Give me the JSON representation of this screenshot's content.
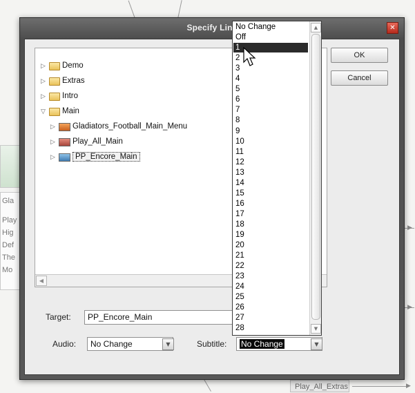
{
  "dialog": {
    "title": "Specify Link"
  },
  "buttons": {
    "ok": "OK",
    "cancel": "Cancel"
  },
  "tree": {
    "items": [
      {
        "label": "Demo",
        "expanded": false,
        "icon": "folder-icon"
      },
      {
        "label": "Extras",
        "expanded": false,
        "icon": "folder-icon"
      },
      {
        "label": "Intro",
        "expanded": false,
        "icon": "folder-icon"
      },
      {
        "label": "Main",
        "expanded": true,
        "icon": "folder-icon",
        "children": [
          {
            "label": "Gladiators_Football_Main_Menu",
            "icon": "menu-icon"
          },
          {
            "label": "Play_All_Main",
            "icon": "timeline-icon"
          },
          {
            "label": "PP_Encore_Main",
            "icon": "slideshow-icon",
            "selected": true
          }
        ]
      }
    ]
  },
  "target": {
    "label": "Target:",
    "value": "PP_Encore_Main"
  },
  "audio": {
    "label": "Audio:",
    "value": "No Change"
  },
  "subtitle": {
    "label": "Subtitle:",
    "value": "No Change"
  },
  "subtitle_options": {
    "selected_index": 2,
    "items": [
      "No Change",
      "Off",
      "1",
      "2",
      "3",
      "4",
      "5",
      "6",
      "7",
      "8",
      "9",
      "10",
      "11",
      "12",
      "13",
      "14",
      "15",
      "16",
      "17",
      "18",
      "19",
      "20",
      "21",
      "22",
      "23",
      "24",
      "25",
      "26",
      "27",
      "28"
    ]
  },
  "background": {
    "left_snippets": [
      "Gla",
      "Play",
      "Hig",
      "Def",
      "The",
      "Mo"
    ],
    "bottom_tag": "Play_All_Extras"
  },
  "colors": {
    "highlight": "#2b2b2b",
    "dialog_frame": "#5a5a5a"
  }
}
